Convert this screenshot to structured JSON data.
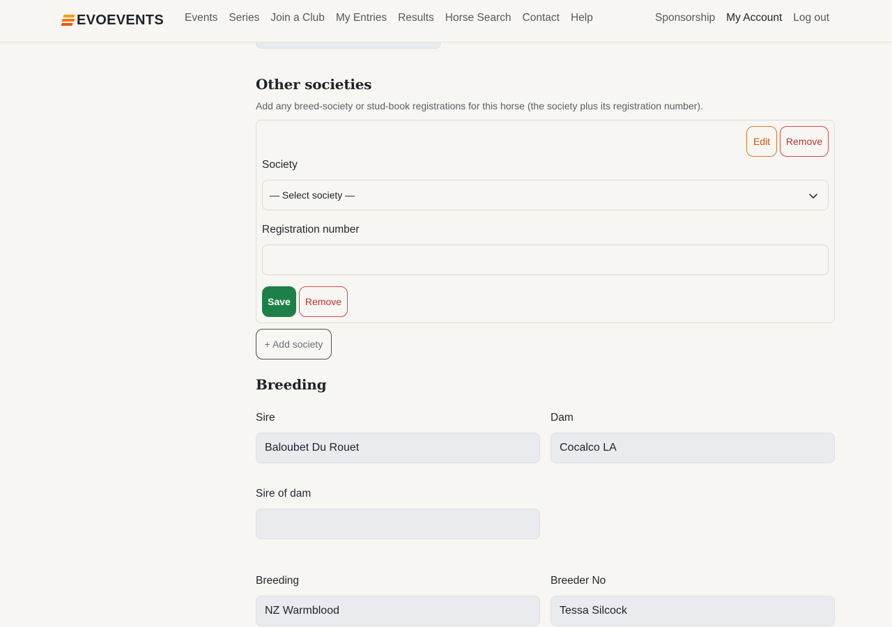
{
  "brand": {
    "name": "EVOEVENTS"
  },
  "nav": {
    "items": [
      "Events",
      "Series",
      "Join a Club",
      "My Entries",
      "Results",
      "Horse Search",
      "Contact",
      "Help"
    ],
    "right": [
      "Sponsorship",
      "My Account",
      "Log out"
    ]
  },
  "societies": {
    "title": "Other societies",
    "description": "Add any breed-society or stud-book registrations for this horse (the society plus its registration number).",
    "edit_label": "Edit",
    "remove_label": "Remove",
    "society_label": "Society",
    "society_value": "— Select society —",
    "reg_label": "Registration number",
    "reg_value": "",
    "save_label": "Save",
    "row_remove_label": "Remove",
    "add_label": "+ Add society"
  },
  "breeding": {
    "title": "Breeding",
    "sire_label": "Sire",
    "sire_value": "Baloubet Du Rouet",
    "dam_label": "Dam",
    "dam_value": "Cocalco LA",
    "sire_of_dam_label": "Sire of dam",
    "sire_of_dam_value": "",
    "breeding_label": "Breeding",
    "breeding_value": "NZ Warmblood",
    "breeder_label": "Breeder No",
    "breeder_value": "Tessa Silcock"
  },
  "colors": {
    "accent_orange": "#f97316",
    "save_green": "#1d8049",
    "remove_red": "#c43131",
    "edit_orange": "#c2571a"
  }
}
